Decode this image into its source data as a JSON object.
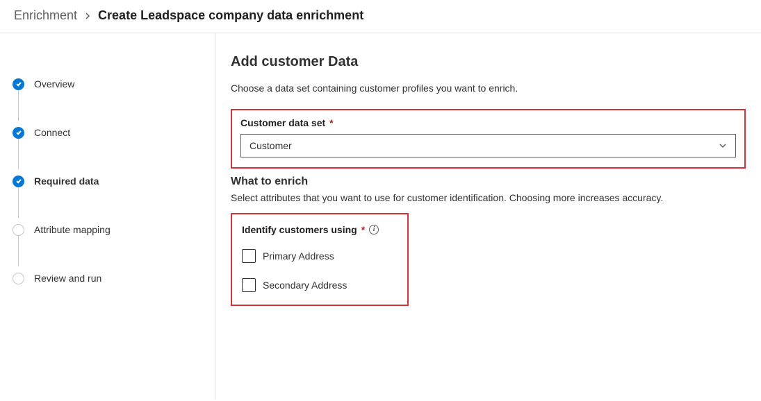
{
  "breadcrumb": {
    "parent": "Enrichment",
    "current": "Create Leadspace company data enrichment"
  },
  "steps": [
    {
      "label": "Overview",
      "state": "done"
    },
    {
      "label": "Connect",
      "state": "done"
    },
    {
      "label": "Required data",
      "state": "done",
      "active": true
    },
    {
      "label": "Attribute mapping",
      "state": "pending"
    },
    {
      "label": "Review and run",
      "state": "pending"
    }
  ],
  "main": {
    "title": "Add customer Data",
    "description": "Choose a data set containing customer profiles you want to enrich.",
    "dataset": {
      "label": "Customer data set",
      "value": "Customer"
    },
    "enrich": {
      "heading": "What to enrich",
      "description": "Select attributes that you want to use for customer identification. Choosing more increases accuracy.",
      "identify_label": "Identify customers using",
      "options": [
        {
          "label": "Primary Address"
        },
        {
          "label": "Secondary Address"
        }
      ]
    }
  }
}
